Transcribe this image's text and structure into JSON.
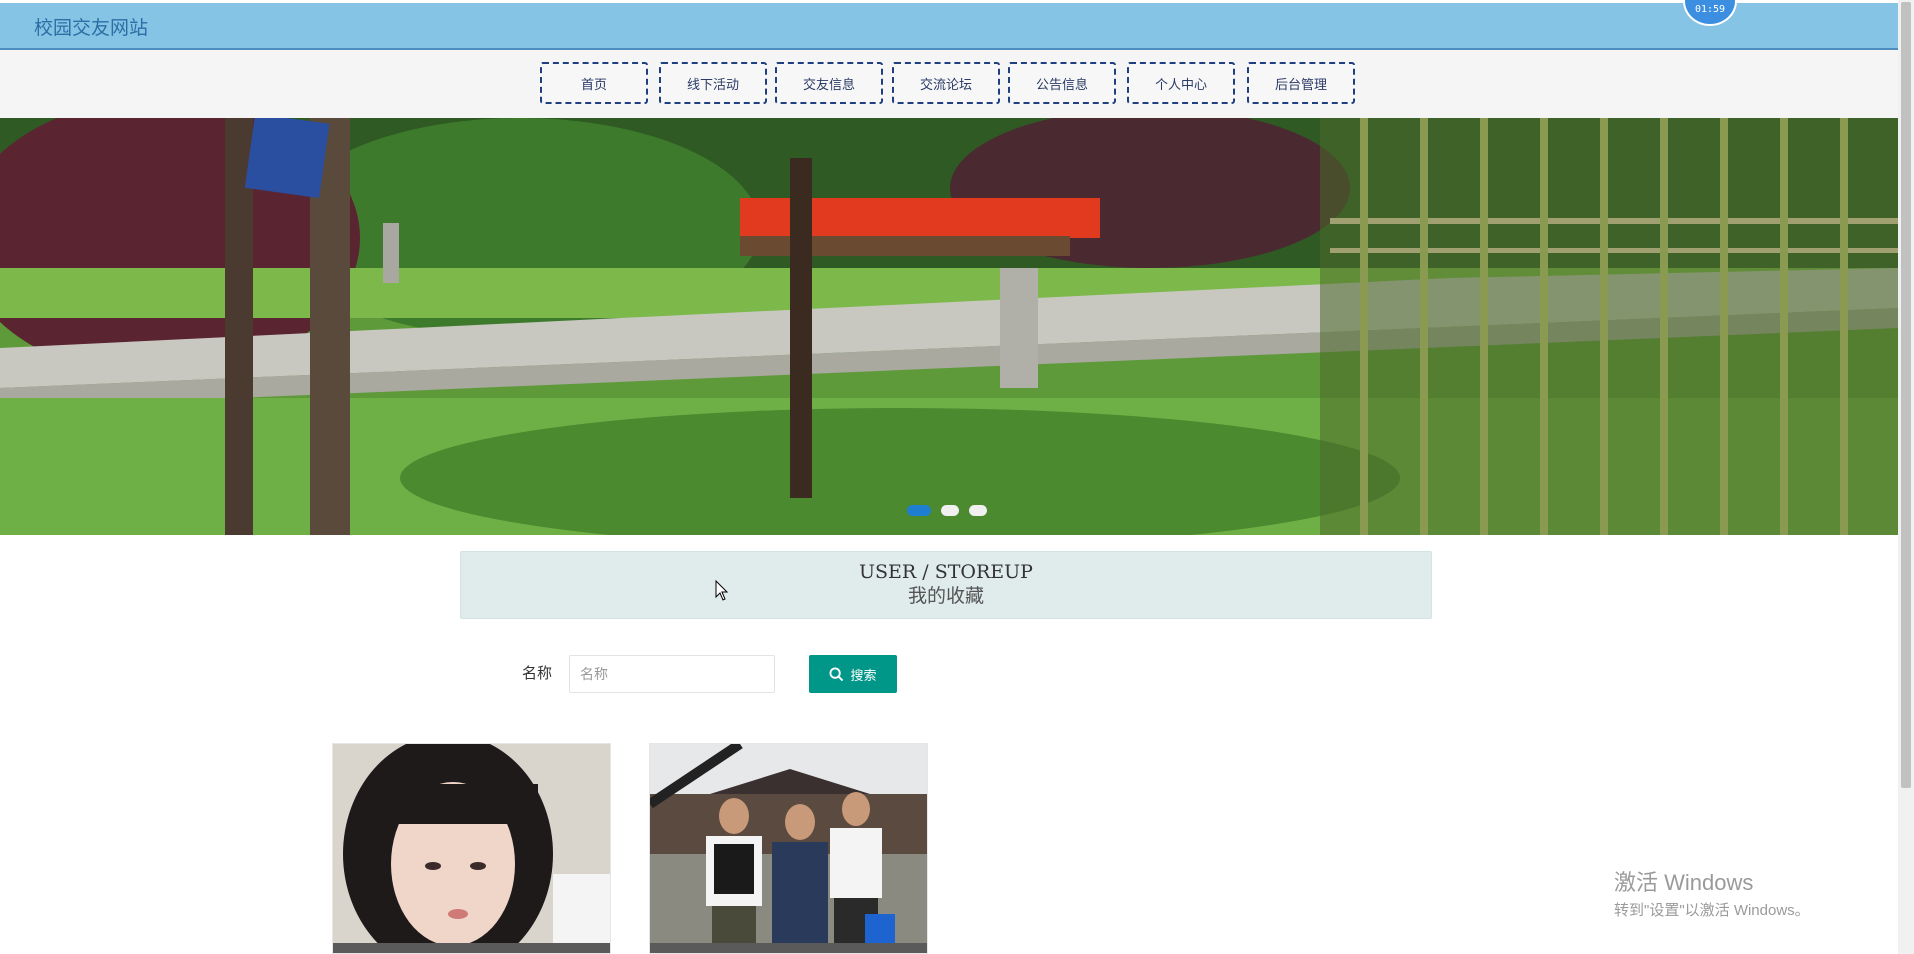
{
  "header": {
    "site_title": "校园交友网站",
    "timer": "01:59"
  },
  "nav": {
    "items": [
      {
        "label": "首页"
      },
      {
        "label": "线下活动"
      },
      {
        "label": "交友信息"
      },
      {
        "label": "交流论坛"
      },
      {
        "label": "公告信息"
      },
      {
        "label": "个人中心"
      },
      {
        "label": "后台管理"
      }
    ]
  },
  "carousel": {
    "slide_count": 3,
    "active_index": 0
  },
  "section": {
    "title_en": "USER / STOREUP",
    "title_cn": "我的收藏"
  },
  "search": {
    "label": "名称",
    "placeholder": "名称",
    "value": "",
    "button_label": "搜索",
    "button_icon": "search-icon",
    "button_color": "#009688"
  },
  "cards": [
    {
      "image": "portrait-photo"
    },
    {
      "image": "group-photo"
    }
  ],
  "watermark": {
    "title": "激活 Windows",
    "subtitle": "转到\"设置\"以激活 Windows。"
  },
  "colors": {
    "header_bg": "#85c4e4",
    "nav_border": "#1f3f80",
    "dot_active": "#1e7fd0"
  }
}
